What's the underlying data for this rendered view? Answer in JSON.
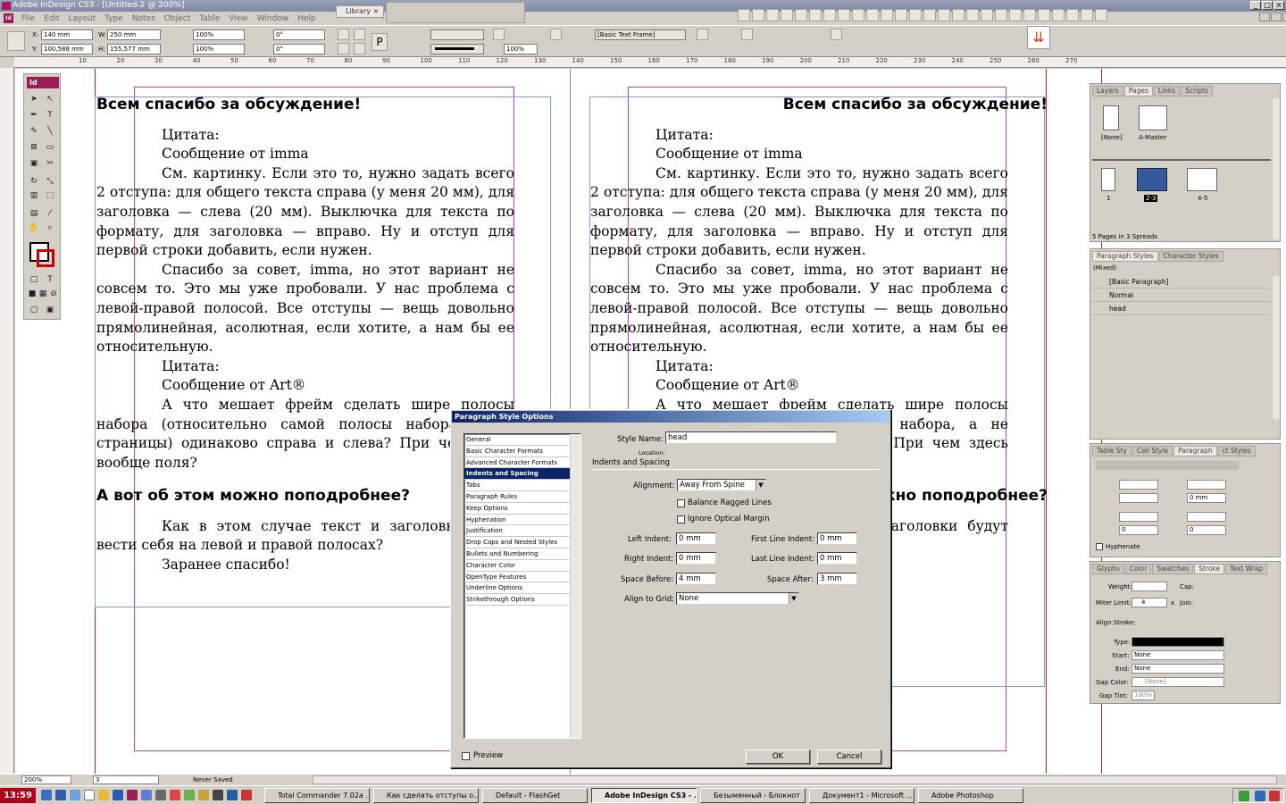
{
  "window": {
    "title": "Adobe InDesign CS3 - [Untitled-2 @ 200%]"
  },
  "menu": [
    "File",
    "Edit",
    "Layout",
    "Type",
    "Notes",
    "Object",
    "Table",
    "View",
    "Window",
    "Help"
  ],
  "library_tab": "Library",
  "control": {
    "x": "140 mm",
    "y": "100,588 mm",
    "w": "250 mm",
    "h": "155,577 mm",
    "scale_x": "100%",
    "scale_y": "100%",
    "rotate": "0°",
    "shear": "0°",
    "style": "[Basic Text Frame]",
    "opacity": "100%"
  },
  "ruler_ticks": [
    "10",
    "20",
    "30",
    "40",
    "50",
    "60",
    "70",
    "80",
    "90",
    "100",
    "110",
    "120",
    "130",
    "140",
    "150",
    "160",
    "170",
    "180",
    "190",
    "200",
    "210",
    "220",
    "230",
    "240",
    "250",
    "260",
    "270"
  ],
  "document": {
    "left": {
      "heading1": "Всем спасибо за обсуждение!",
      "p1": "Цитата:",
      "p2": "Сообщение от imma",
      "p3": "См. картинку. Если это то, нужно задать всего 2 отступа: для общего текста справа (у меня 20 мм), для заголовка — слева (20 мм). Выключка для текста по формату, для заголовка — вправо. Ну и отступ для первой строки добавить, если нужен.",
      "p4": "Спасибо за совет, imma, но этот вариант не совсем то. Это мы уже пробовали. У нас проблема с левой-правой полосой. Все отступы — вещь довольно прямолинейная, асолютная, если хотите, а нам бы ее относительную.",
      "p5": "Цитата:",
      "p6": "Сообщение от Art®",
      "p7": "А что мешает фрейм сделать шире полосы набора (относительно самой полосы набора, а не страницы) одинаково справа и слева? При чем здесь вообще поля?",
      "heading2": "А вот об этом можно поподробнее?",
      "p8": "Как в этом случае текст и заголовки будут вести себя на левой и правой полосах?",
      "p9": "Заранее спасибо!"
    }
  },
  "panels": {
    "pages": {
      "tabs": [
        "Layers",
        "Pages",
        "Links",
        "Scripts"
      ],
      "masters": [
        "[None]",
        "A-Master"
      ],
      "spreads": [
        "1",
        "2-3",
        "4-5"
      ],
      "footer": "5 Pages in 3 Spreads"
    },
    "para_styles": {
      "tabs": [
        "Paragraph Styles",
        "Character Styles"
      ],
      "current": "(Mixed)",
      "items": [
        "[Basic Paragraph]",
        "Normal",
        "head"
      ]
    },
    "paragraph": {
      "tabs": [
        "Table Sty",
        "Cell Style",
        "Paragraph",
        "ct Styles"
      ],
      "fields": [
        "",
        "",
        "",
        "",
        "0 mm",
        "",
        "",
        "0",
        "0"
      ],
      "hyphenate": "Hyphenate"
    },
    "stroke": {
      "tabs": [
        "Glyphs",
        "Color",
        "Swatches",
        "Stroke",
        "Text Wrap"
      ],
      "weight_label": "Weight:",
      "cap_label": "Cap:",
      "miter_label": "Miter Limit:",
      "miter_value": "4",
      "x": "x",
      "join_label": "Join:",
      "align_label": "Align Stroke:",
      "type_label": "Type:",
      "start_label": "Start:",
      "start_value": "None",
      "end_label": "End:",
      "end_value": "None",
      "gap_color_label": "Gap Color:",
      "gap_color_value": "[None]",
      "gap_tint_label": "Gap Tint:",
      "gap_tint_value": "100%"
    }
  },
  "dialog": {
    "title": "Paragraph Style Options",
    "categories": [
      "General",
      "Basic Character Formats",
      "Advanced Character Formats",
      "Indents and Spacing",
      "Tabs",
      "Paragraph Rules",
      "Keep Options",
      "Hyphenation",
      "Justification",
      "Drop Caps and Nested Styles",
      "Bullets and Numbering",
      "Character Color",
      "OpenType Features",
      "Underline Options",
      "Strikethrough Options"
    ],
    "selected_index": 3,
    "style_name_label": "Style Name:",
    "style_name": "head",
    "location_label": "Location:",
    "section": "Indents and Spacing",
    "alignment_label": "Alignment:",
    "alignment": "Away From Spine",
    "balance": "Balance Ragged Lines",
    "ignore": "Ignore Optical Margin",
    "left_indent_label": "Left Indent:",
    "left_indent": "0 mm",
    "first_line_label": "First Line Indent:",
    "first_line": "0 mm",
    "right_indent_label": "Right Indent:",
    "right_indent": "0 mm",
    "last_line_label": "Last Line Indent:",
    "last_line": "0 mm",
    "space_before_label": "Space Before:",
    "space_before": "4 mm",
    "space_after_label": "Space After:",
    "space_after": "3 mm",
    "align_grid_label": "Align to Grid:",
    "align_grid": "None",
    "preview": "Preview",
    "ok": "OK",
    "cancel": "Cancel"
  },
  "status": {
    "zoom": "200%",
    "page": "3",
    "saved": "Never Saved"
  },
  "taskbar": {
    "clock": "13:59",
    "tasks": [
      "Total Commander 7.02a ...",
      "Как сделать отступы о...",
      "Default - FlashGet",
      "Adobe InDesign CS3 - ...",
      "Безымянный - Блокнот",
      "Документ1 - Microsoft ...",
      "Adobe Photoshop"
    ],
    "active_index": 3
  }
}
